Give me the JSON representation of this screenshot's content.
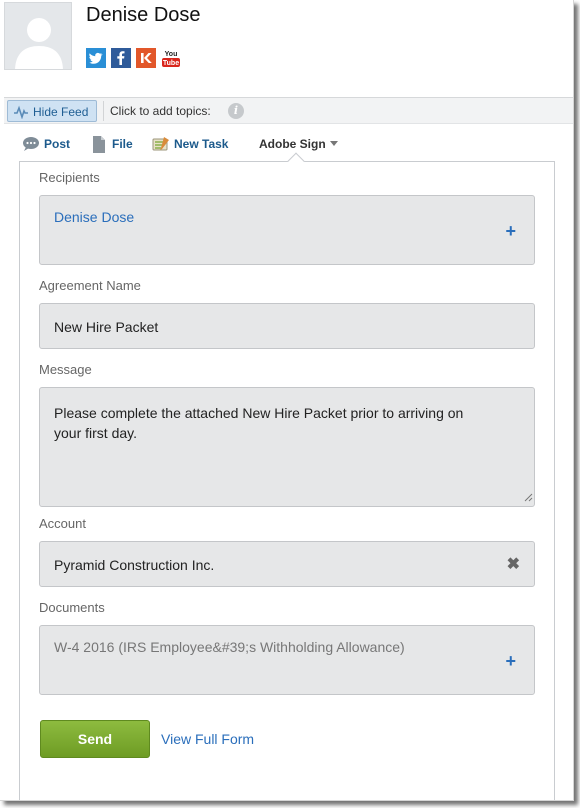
{
  "profile": {
    "name": "Denise Dose",
    "social_icons": [
      "twitter-icon",
      "facebook-icon",
      "klout-icon",
      "youtube-icon"
    ],
    "youtube_label_1": "You",
    "youtube_label_2": "Tube"
  },
  "feedbar": {
    "hide_feed_label": "Hide Feed",
    "topics_text": "Click to add topics:",
    "info_glyph": "i"
  },
  "publisher": {
    "tabs": [
      {
        "label": "Post",
        "icon": "chat-bubble-icon"
      },
      {
        "label": "File",
        "icon": "file-icon"
      },
      {
        "label": "New Task",
        "icon": "task-icon"
      },
      {
        "label": "Adobe Sign",
        "icon": "chevron-down-icon",
        "selected": true
      }
    ]
  },
  "form": {
    "recipients": {
      "label": "Recipients",
      "value": "Denise Dose",
      "add_glyph": "+"
    },
    "agreement_name": {
      "label": "Agreement Name",
      "value": "New Hire Packet"
    },
    "message": {
      "label": "Message",
      "line1": "Please complete the attached New Hire Packet prior to arriving on",
      "line2": "your first day."
    },
    "account": {
      "label": "Account",
      "value": "Pyramid Construction Inc.",
      "clear_glyph": "✖"
    },
    "documents": {
      "label": "Documents",
      "value": "W-4 2016 (IRS Employee&#39;s Withholding Allowance)",
      "add_glyph": "+"
    },
    "send_label": "Send",
    "full_form_label": "View Full Form"
  },
  "colors": {
    "link": "#2a6ebb",
    "send_button": "#7aa82e",
    "field_bg": "#e6e7e8"
  }
}
